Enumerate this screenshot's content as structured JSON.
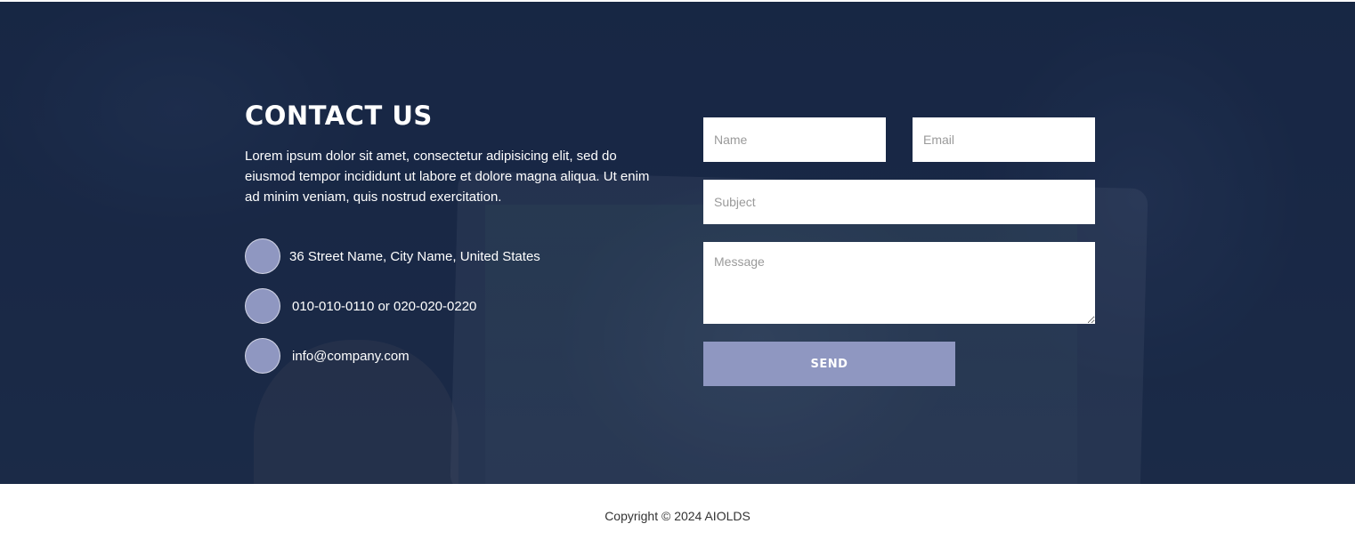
{
  "contact": {
    "title": "CONTACT US",
    "description": "Lorem ipsum dolor sit amet, consectetur adipisicing elit, sed do eiusmod tempor incididunt ut labore et dolore magna aliqua. Ut enim ad minim veniam, quis nostrud exercitation.",
    "items": [
      {
        "icon": "map-marker-icon",
        "glyph": "",
        "text": "36 Street Name, City Name, United States"
      },
      {
        "icon": "phone-icon",
        "glyph": "",
        "text": "010-010-0110 or 020-020-0220"
      },
      {
        "icon": "envelope-icon",
        "glyph": "",
        "text": "info@company.com"
      }
    ]
  },
  "form": {
    "name_placeholder": "Name",
    "email_placeholder": "Email",
    "subject_placeholder": "Subject",
    "message_placeholder": "Message",
    "send_label": "SEND"
  },
  "footer": {
    "copyright": "Copyright © 2024 AIOLDS"
  },
  "colors": {
    "accent": "#8f97c1",
    "overlay": "#1b2a4a",
    "text_light": "#ffffff"
  }
}
